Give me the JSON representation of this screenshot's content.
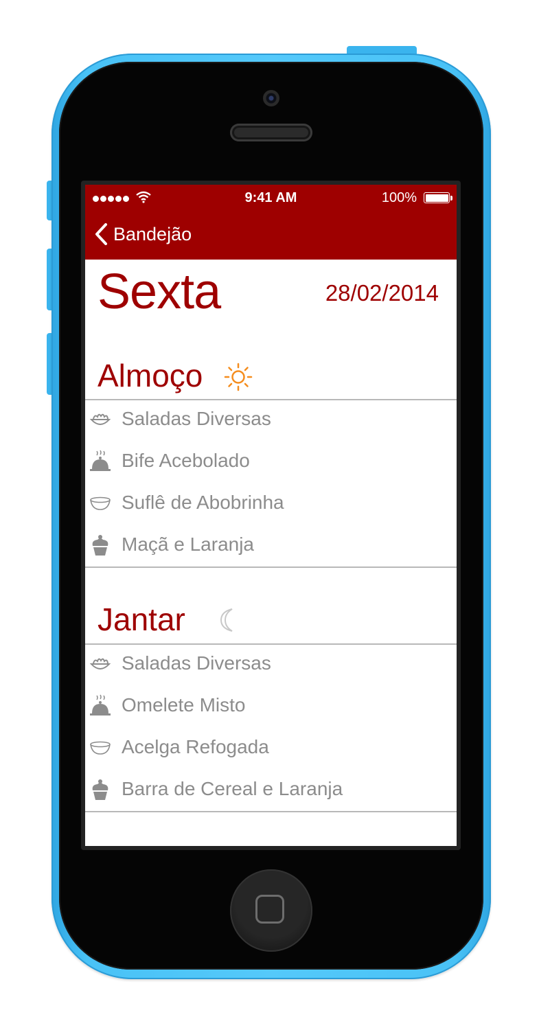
{
  "colors": {
    "accent": "#9e0000",
    "sun": "#f58d1e",
    "item_text": "#8c8c8c",
    "moon": "#c8c8c8",
    "device_shell": "#4fc5f7"
  },
  "status_bar": {
    "carrier_signal_icon": "signal-dots-icon",
    "wifi_icon": "wifi-icon",
    "time": "9:41 AM",
    "battery_percent": "100%",
    "battery_level": 1.0
  },
  "navbar": {
    "back_label": "Bandejão",
    "back_icon": "chevron-left-icon"
  },
  "header": {
    "day": "Sexta",
    "date": "28/02/2014"
  },
  "meals": [
    {
      "title": "Almoço",
      "icon": "sun-icon",
      "items": [
        {
          "icon": "salad-bowl-icon",
          "label": "Saladas Diversas"
        },
        {
          "icon": "cloche-icon",
          "label": "Bife Acebolado"
        },
        {
          "icon": "side-bowl-icon",
          "label": "Suflê de Abobrinha"
        },
        {
          "icon": "cupcake-icon",
          "label": "Maçã e Laranja"
        }
      ]
    },
    {
      "title": "Jantar",
      "icon": "moon-icon",
      "items": [
        {
          "icon": "salad-bowl-icon",
          "label": "Saladas Diversas"
        },
        {
          "icon": "cloche-icon",
          "label": "Omelete Misto"
        },
        {
          "icon": "side-bowl-icon",
          "label": "Acelga Refogada"
        },
        {
          "icon": "cupcake-icon",
          "label": "Barra de Cereal e Laranja"
        }
      ]
    }
  ]
}
